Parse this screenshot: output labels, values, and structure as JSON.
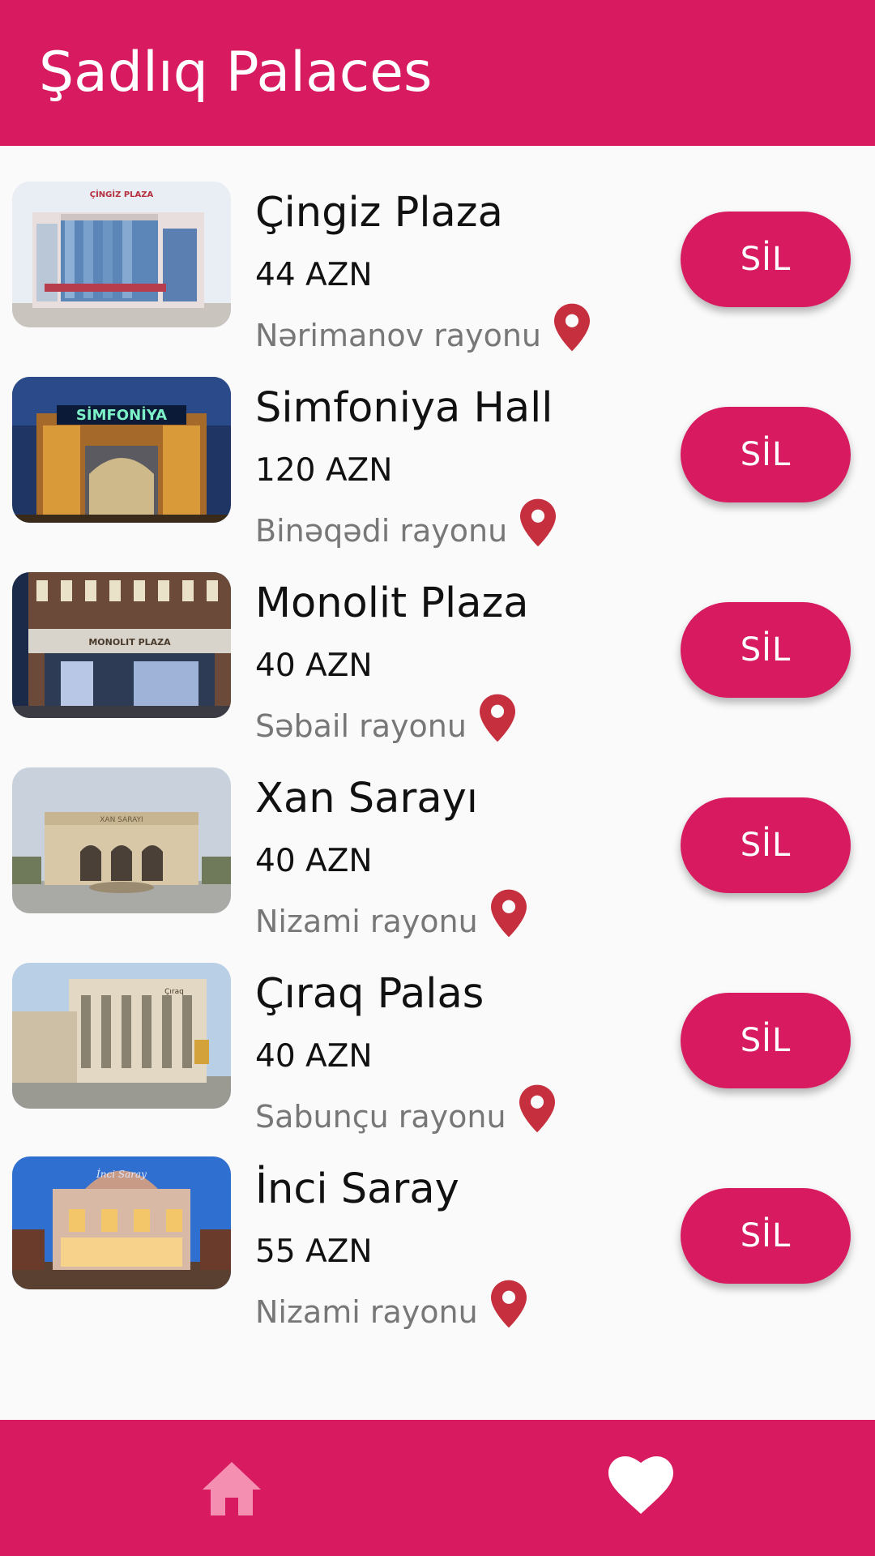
{
  "app_bar": {
    "title": "Şadlıq Palaces"
  },
  "halls": [
    {
      "name": "Çingiz Plaza",
      "price": "44 AZN",
      "district": "Nərimanov rayonu",
      "sign_text": "ÇİNGİZ PLAZA",
      "delete_label": "SİL"
    },
    {
      "name": "Simfoniya Hall",
      "price": "120 AZN",
      "district": "Binəqədi rayonu",
      "sign_text": "SİMFONİYA",
      "delete_label": "SİL"
    },
    {
      "name": "Monolit Plaza",
      "price": "40 AZN",
      "district": "Səbail rayonu",
      "sign_text": "MONOLIT PLAZA",
      "delete_label": "SİL"
    },
    {
      "name": "Xan Sarayı",
      "price": "40 AZN",
      "district": "Nizami rayonu",
      "sign_text": "XAN SARAYI",
      "delete_label": "SİL"
    },
    {
      "name": "Çıraq Palas",
      "price": "40 AZN",
      "district": "Sabunçu rayonu",
      "sign_text": "Çıraq",
      "delete_label": "SİL"
    },
    {
      "name": "İnci Saray",
      "price": "55 AZN",
      "district": "Nizami rayonu",
      "sign_text": "İnci Saray",
      "delete_label": "SİL"
    }
  ],
  "bottom_nav": {
    "home_icon": "home-icon",
    "favorites_icon": "heart-icon",
    "home_active": false,
    "favorites_active": true
  },
  "colors": {
    "primary": "#d81b60",
    "pin": "#c62f3e",
    "inactive_nav_icon": "#f48fb1",
    "active_nav_icon": "#ffffff"
  }
}
